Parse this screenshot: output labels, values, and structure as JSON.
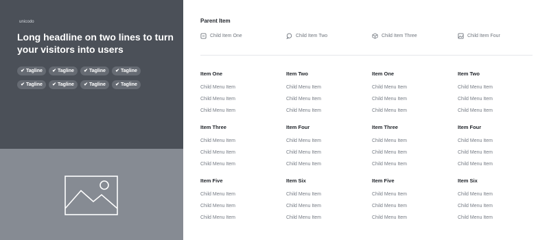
{
  "left": {
    "logo": "unicodo",
    "headline": "Long headline on two lines to turn your visitors into users",
    "tags": [
      "Tagline",
      "Tagline",
      "Tagline",
      "Tagline",
      "Tagline",
      "Tagline",
      "Tagline",
      "Tagline"
    ],
    "image_icon": "image-placeholder-icon"
  },
  "right": {
    "parent_title": "Parent Item",
    "children": [
      {
        "label": "Child Item One",
        "icon": "square-icon"
      },
      {
        "label": "Child Item Two",
        "icon": "chat-icon"
      },
      {
        "label": "Child Item Three",
        "icon": "cube-icon"
      },
      {
        "label": "Child Item Four",
        "icon": "image-icon"
      }
    ],
    "columns": [
      {
        "groups": [
          {
            "title": "Item One",
            "items": [
              "Child Menu Item",
              "Child Menu Item",
              "Child Menu Item"
            ]
          },
          {
            "title": "Item Three",
            "items": [
              "Child Menu Item",
              "Child Menu Item",
              "Child Menu Item"
            ]
          },
          {
            "title": "Item Five",
            "items": [
              "Child Menu Item",
              "Child Menu Item",
              "Child Menu Item"
            ]
          }
        ]
      },
      {
        "groups": [
          {
            "title": "Item Two",
            "items": [
              "Child Menu Item",
              "Child Menu Item",
              "Child Menu Item"
            ]
          },
          {
            "title": "Item Four",
            "items": [
              "Child Menu Item",
              "Child Menu Item",
              "Child Menu Item"
            ]
          },
          {
            "title": "Item Six",
            "items": [
              "Child Menu Item",
              "Child Menu Item",
              "Child Menu Item"
            ]
          }
        ]
      },
      {
        "groups": [
          {
            "title": "Item One",
            "items": [
              "Child Menu Item",
              "Child Menu Item",
              "Child Menu Item"
            ]
          },
          {
            "title": "Item Three",
            "items": [
              "Child Menu Item",
              "Child Menu Item",
              "Child Menu Item"
            ]
          },
          {
            "title": "Item Five",
            "items": [
              "Child Menu Item",
              "Child Menu Item",
              "Child Menu Item"
            ]
          }
        ]
      },
      {
        "groups": [
          {
            "title": "Item Two",
            "items": [
              "Child Menu Item",
              "Child Menu Item",
              "Child Menu Item"
            ]
          },
          {
            "title": "Item Four",
            "items": [
              "Child Menu Item",
              "Child Menu Item",
              "Child Menu Item"
            ]
          },
          {
            "title": "Item Six",
            "items": [
              "Child Menu Item",
              "Child Menu Item",
              "Child Menu Item"
            ]
          }
        ]
      }
    ]
  },
  "colors": {
    "hero_bg": "#4b5058",
    "media_bg": "#868b93",
    "tag_bg": "#666b73",
    "text_dark": "#1f2329",
    "text_muted": "#747a83"
  }
}
